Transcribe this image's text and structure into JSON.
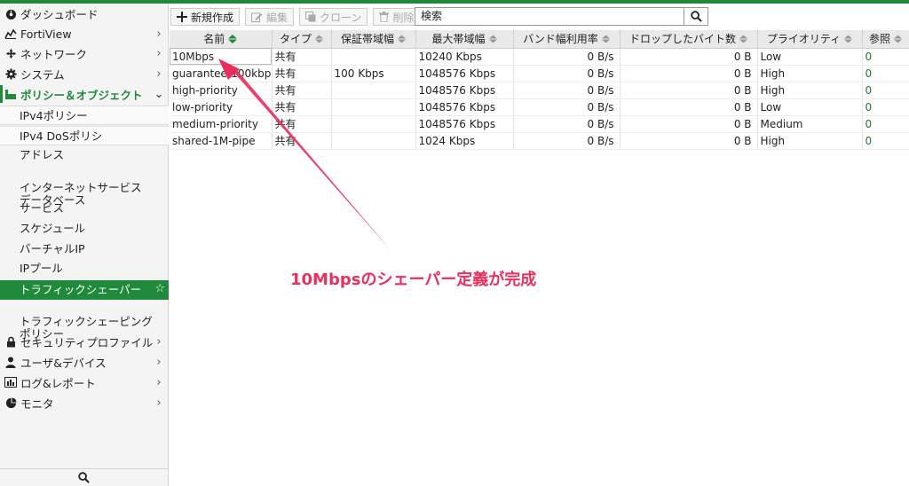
{
  "colors": {
    "accent": "#1f8a3b",
    "annotation": "#e8305f"
  },
  "sidebar": {
    "items": [
      {
        "label": "ダッシュボード",
        "icon": "dashboard-icon",
        "chevron": false
      },
      {
        "label": "FortiView",
        "icon": "chart-icon",
        "chevron": true
      },
      {
        "label": "ネットワーク",
        "icon": "network-icon",
        "chevron": true
      },
      {
        "label": "システム",
        "icon": "gear-icon",
        "chevron": true
      },
      {
        "label": "ポリシー＆オブジェクト",
        "icon": "policy-icon",
        "chevron": true
      }
    ],
    "subitems": [
      "IPv4ポリシー",
      "IPv4 DoSポリシ",
      "アドレス",
      "インターネットサービス\nデータベース",
      "サービス",
      "スケジュール",
      "バーチャルIP",
      "IPプール",
      "トラフィックシェーパー",
      "トラフィックシェーピング\nポリシー"
    ],
    "bottom_items": [
      {
        "label": "セキュリティプロファイル",
        "icon": "lock-icon"
      },
      {
        "label": "ユーザ&デバイス",
        "icon": "user-icon"
      },
      {
        "label": "ログ&レポート",
        "icon": "bar-chart-icon"
      },
      {
        "label": "モニタ",
        "icon": "pie-chart-icon"
      }
    ]
  },
  "toolbar": {
    "new_label": "新規作成",
    "edit_label": "編集",
    "clone_label": "クローン",
    "delete_label": "削除",
    "search_value": "検索"
  },
  "table": {
    "columns": [
      "名前",
      "タイプ",
      "保証帯域幅",
      "最大帯域幅",
      "バンド幅利用率",
      "ドロップしたバイト数",
      "プライオリティ",
      "参照"
    ],
    "rows": [
      [
        "10Mbps",
        "共有",
        "",
        "10240 Kbps",
        "0 B/s",
        "0 B",
        "Low",
        "0"
      ],
      [
        "guarantee-100kbps",
        "共有",
        "100 Kbps",
        "1048576 Kbps",
        "0 B/s",
        "0 B",
        "High",
        "0"
      ],
      [
        "high-priority",
        "共有",
        "",
        "1048576 Kbps",
        "0 B/s",
        "0 B",
        "High",
        "0"
      ],
      [
        "low-priority",
        "共有",
        "",
        "1048576 Kbps",
        "0 B/s",
        "0 B",
        "Low",
        "0"
      ],
      [
        "medium-priority",
        "共有",
        "",
        "1048576 Kbps",
        "0 B/s",
        "0 B",
        "Medium",
        "0"
      ],
      [
        "shared-1M-pipe",
        "共有",
        "",
        "1024 Kbps",
        "0 B/s",
        "0 B",
        "High",
        "0"
      ]
    ]
  },
  "annotation": {
    "text": "10Mbpsのシェーパー定義が完成"
  }
}
